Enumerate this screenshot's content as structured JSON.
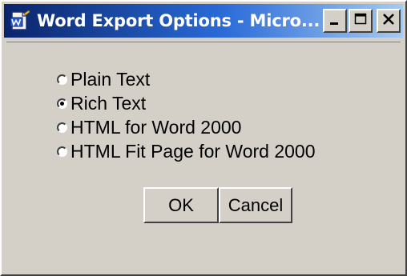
{
  "window": {
    "title": "Word Export Options - Micro...",
    "icon": "word-document-icon",
    "title_gradient": [
      "#0a246a",
      "#a6caf0"
    ],
    "face_color": "#d4d0c8",
    "controls": {
      "minimize": "minimize-icon",
      "maximize": "maximize-icon",
      "close": "close-icon"
    }
  },
  "options": [
    {
      "label": "Plain Text",
      "checked": false
    },
    {
      "label": "Rich Text",
      "checked": true
    },
    {
      "label": "HTML for Word 2000",
      "checked": false
    },
    {
      "label": "HTML Fit Page for Word 2000",
      "checked": false
    }
  ],
  "buttons": {
    "ok_label": "OK",
    "cancel_label": "Cancel"
  }
}
